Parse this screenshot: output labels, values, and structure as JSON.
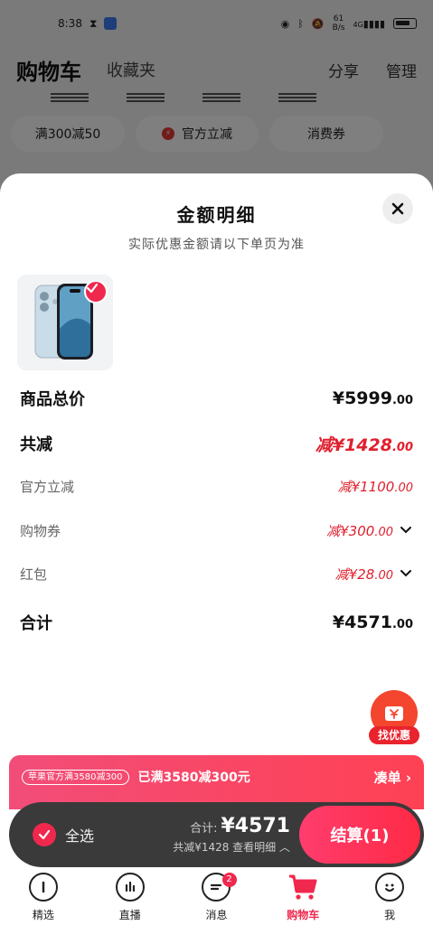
{
  "status_bar": {
    "time": "8:38",
    "net_speed_value": "61",
    "net_speed_unit": "B/s",
    "signal": "4G",
    "battery": "100"
  },
  "background_page": {
    "title": "购物车",
    "favorites": "收藏夹",
    "share": "分享",
    "manage": "管理",
    "chips": [
      "满300减50",
      "官方立减",
      "消费券"
    ]
  },
  "sheet": {
    "title": "金额明细",
    "subtitle": "实际优惠金额请以下单页为准",
    "rows": {
      "total_price": {
        "label": "商品总价",
        "value": "¥5999",
        "cents": ".00"
      },
      "total_discount": {
        "label": "共减",
        "value": "减¥1428",
        "cents": ".00"
      },
      "official_discount": {
        "label": "官方立减",
        "value": "减¥1100",
        "cents": ".00"
      },
      "shopping_coupon": {
        "label": "购物券",
        "value": "减¥300",
        "cents": ".00"
      },
      "red_packet": {
        "label": "红包",
        "value": "减¥28",
        "cents": ".00"
      },
      "sum": {
        "label": "合计",
        "value": "¥4571",
        "cents": ".00"
      }
    }
  },
  "float_coupon": {
    "label": "找优惠"
  },
  "promo": {
    "tag": "苹果官方满3580减300",
    "text": "已满3580减300元",
    "link": "凑单 ›"
  },
  "checkout": {
    "select_all": "全选",
    "total_label": "合计:",
    "total_value": "¥4571",
    "saving": "共减¥1428 查看明细 ︿",
    "button": "结算(1)"
  },
  "tabbar": {
    "tabs": [
      {
        "label": "精选",
        "icon": "home-icon"
      },
      {
        "label": "直播",
        "icon": "live-icon"
      },
      {
        "label": "消息",
        "icon": "message-icon",
        "badge": "2"
      },
      {
        "label": "购物车",
        "icon": "cart-icon",
        "active": true
      },
      {
        "label": "我",
        "icon": "profile-icon"
      }
    ]
  },
  "colors": {
    "accent": "#f0284e",
    "discount_red": "#e0202e",
    "checkout_bar": "#3a3a3a"
  }
}
